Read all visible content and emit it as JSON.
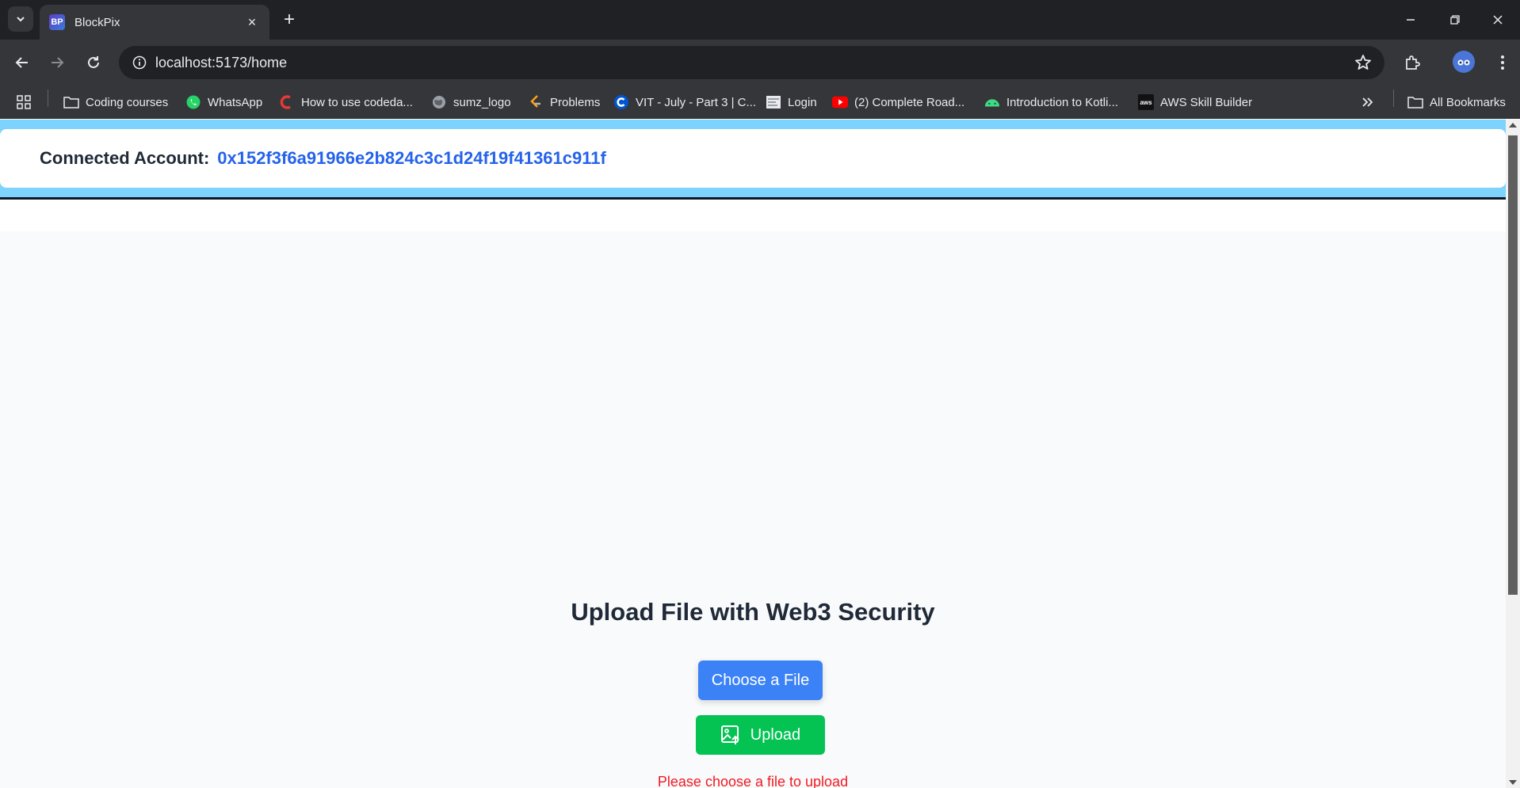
{
  "browser": {
    "tab": {
      "favicon_text": "BP",
      "title": "BlockPix",
      "close": "×"
    },
    "new_tab": "+",
    "url": "localhost:5173/home"
  },
  "bookmarks": [
    {
      "label": "Coding courses",
      "icon": "folder-icon"
    },
    {
      "label": "WhatsApp",
      "icon": "whatsapp-icon"
    },
    {
      "label": "How to use codeda...",
      "icon": "codedamn-icon"
    },
    {
      "label": "sumz_logo",
      "icon": "globe-icon"
    },
    {
      "label": "Problems",
      "icon": "leetcode-icon"
    },
    {
      "label": "VIT - July - Part 3 | C...",
      "icon": "coursera-icon"
    },
    {
      "label": "Login",
      "icon": "page-icon"
    },
    {
      "label": "(2) Complete Road...",
      "icon": "youtube-icon"
    },
    {
      "label": "Introduction to Kotli...",
      "icon": "android-icon"
    },
    {
      "label": "AWS Skill Builder",
      "icon": "aws-icon"
    }
  ],
  "all_bookmarks": "All Bookmarks",
  "aws_badge": "aws",
  "navbar": {
    "label": "Connected Account:",
    "address": "0x152f3f6a91966e2b824c3c1d24f19f41361c911f"
  },
  "upload": {
    "title": "Upload File with Web3 Security",
    "choose_label": "Choose a File",
    "upload_label": "Upload",
    "error": "Please choose a file to upload"
  },
  "colors": {
    "navbar_band": "#7dd3fc",
    "address": "#2563eb",
    "choose_button": "#3b82f6",
    "upload_button": "#04c353",
    "error": "#ef1c24"
  }
}
